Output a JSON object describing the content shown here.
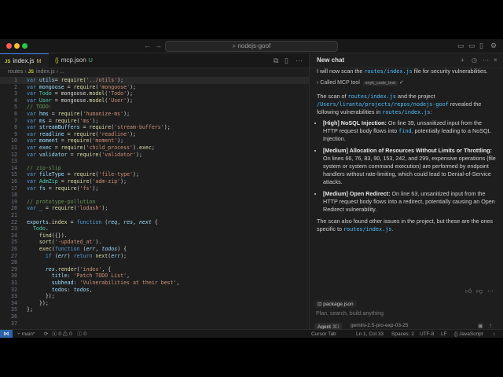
{
  "window": {
    "search": "nodejs-goof"
  },
  "tabs": [
    {
      "label": "index.js",
      "badge": "M",
      "icon": "JS"
    },
    {
      "label": "mcp.json",
      "badge": "U",
      "icon": "{}"
    }
  ],
  "breadcrumb": {
    "folder": "routes",
    "file": "index.js",
    "more": "..."
  },
  "editor": {
    "line_numbers": [
      "1",
      "2",
      "3",
      "4",
      "5",
      "6",
      "7",
      "8",
      "9",
      "10",
      "11",
      "12",
      "13",
      "14",
      "15",
      "16",
      "17",
      "18",
      "19",
      "20",
      "21",
      "22",
      "23",
      "24",
      "25",
      "26",
      "27",
      "28",
      "29",
      "30",
      "31",
      "32",
      "33",
      "34",
      "35",
      "36",
      "37"
    ]
  },
  "chat": {
    "title": "New chat",
    "intro_a": "I will now scan the ",
    "intro_code": "routes/index.js",
    "intro_b": " file for security vulnerabilities.",
    "tool_label": "Called MCP tool",
    "tool_name": "snyk_code_test",
    "scan_a": "The scan of ",
    "scan_code1": "routes/index.js",
    "scan_b": " and the project ",
    "scan_code2": "/Users/liranta/projects/repos/nodejs-goof",
    "scan_c": " revealed the following vulnerabilities in ",
    "scan_code3": "routes/index.js",
    "scan_d": ":",
    "findings": [
      {
        "title": "[High] NoSQL Injection:",
        "text_a": " On line 39, unsanitized input from the HTTP request body flows into ",
        "code": "find",
        "text_b": ", potentially leading to a NoSQL Injection."
      },
      {
        "title": "[Medium] Allocation of Resources Without Limits or Throttling:",
        "text_a": " On lines 66, 76, 83, 90, 153, 242, and 299, expensive operations (file system or system command execution) are performed by endpoint handlers without rate-limiting, which could lead to Denial-of-Service attacks.",
        "code": "",
        "text_b": ""
      },
      {
        "title": "[Medium] Open Redirect:",
        "text_a": " On line 63, unsanitized input from the HTTP request body flows into a redirect, potentially causing an Open Redirect vulnerability.",
        "code": "",
        "text_b": ""
      }
    ],
    "outro_a": "The scan also found other issues in the project, but these are the ones specific to ",
    "outro_code": "routes/index.js",
    "outro_b": ".",
    "input": {
      "file_chip": "package.json",
      "placeholder": "Plan, search, build anything",
      "agent": "Agent",
      "agent_shortcut": "⌘I",
      "model": "gemini-2.5-pro-exp-03-25"
    }
  },
  "status": {
    "branch": "main*",
    "errors": "0",
    "warnings": "0",
    "info": "0",
    "cursor_tab": "Cursor Tab",
    "position": "Ln 1, Col 33",
    "spaces": "Spaces: 2",
    "encoding": "UTF-8",
    "eol": "LF",
    "language": "JavaScript"
  },
  "colors": {
    "accent": "#3b82f6",
    "background": "#1e1e1e",
    "string": "#ce9178",
    "keyword": "#569cd6"
  }
}
